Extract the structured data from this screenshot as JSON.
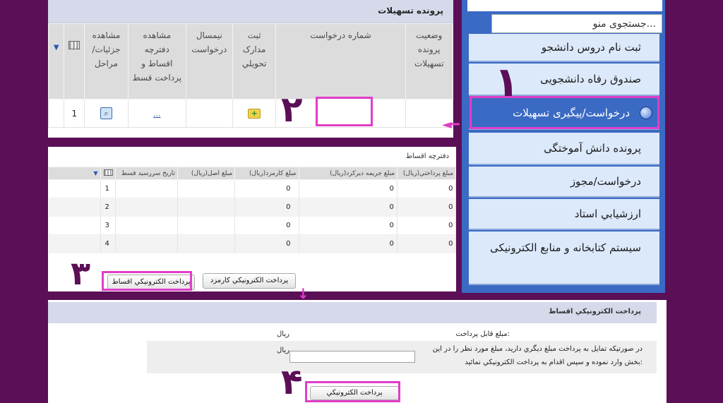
{
  "top_panel": {
    "title": "پرونده تسهيلات",
    "headers": [
      "مشاهده جزئيات/ مراحل",
      "مشاهده دفترچه اقساط و پرداخت قسط",
      "نيمسال درخواست",
      "ثبت مدارک تحويلي",
      "شماره درخواست",
      "وضعيت پرونده تسهيلات"
    ],
    "row": {
      "index": "1",
      "installments_link": "..."
    }
  },
  "installments_panel": {
    "title": "دفترچه اقساط",
    "headers": [
      "تاريخ سررسيد قسط",
      "مبلغ اصل(ريال)",
      "مبلغ کارمزد(ريال)",
      "مبلغ جريمه ديرکرد(ريال)",
      "مبلغ پرداختي(ريال)"
    ],
    "rows": [
      {
        "index": "1",
        "fee": "0",
        "penalty": "0",
        "paid": "0"
      },
      {
        "index": "2",
        "fee": "0",
        "penalty": "0",
        "paid": "0"
      },
      {
        "index": "3",
        "fee": "0",
        "penalty": "0",
        "paid": "0"
      },
      {
        "index": "4",
        "fee": "0",
        "penalty": "0",
        "paid": "0"
      }
    ],
    "btn_fee": "پرداخت الکترونيکي کارمزد",
    "btn_installments": "پرداخت الکترونيکي اقساط"
  },
  "payment_panel": {
    "title": "پرداخت الکترونيکي اقساط",
    "payable_label": "مبلغ قابل پرداخت:",
    "payable_unit": "ريال",
    "desc_line1": "در صورتيکه تمايل به پرداخت مبلغ ديگري داريد، مبلغ مورد نظر را در اين",
    "desc_line2": "بخش وارد نموده و سپس اقدام به پرداخت الکترونيکي نمائيد:",
    "amount_unit": "ريال",
    "amount_value": "",
    "pay_button": "پرداخت الکترونيکي"
  },
  "sidebar": {
    "search_placeholder": "جستجوی منو...",
    "items": [
      {
        "label": "ثبت نام دروس دانشجو"
      },
      {
        "label": "صندوق رفاه دانشجويی"
      },
      {
        "label": "درخواست/پيگيری تسهيلات"
      },
      {
        "label": "پرونده دانش آموختگی"
      },
      {
        "label": "درخواست/مجوز"
      },
      {
        "label": "ارزشيابي استاد"
      },
      {
        "label": "سيستم کتابخانه و منابع الکترونيکی"
      }
    ]
  },
  "step_markers": [
    "۱",
    "۲",
    "۳",
    "۴"
  ],
  "colors": {
    "background": "#5b0f56",
    "highlight": "#e03ec8",
    "sidebar": "#3b6ac4",
    "grid_header": "#dcdcdc"
  }
}
